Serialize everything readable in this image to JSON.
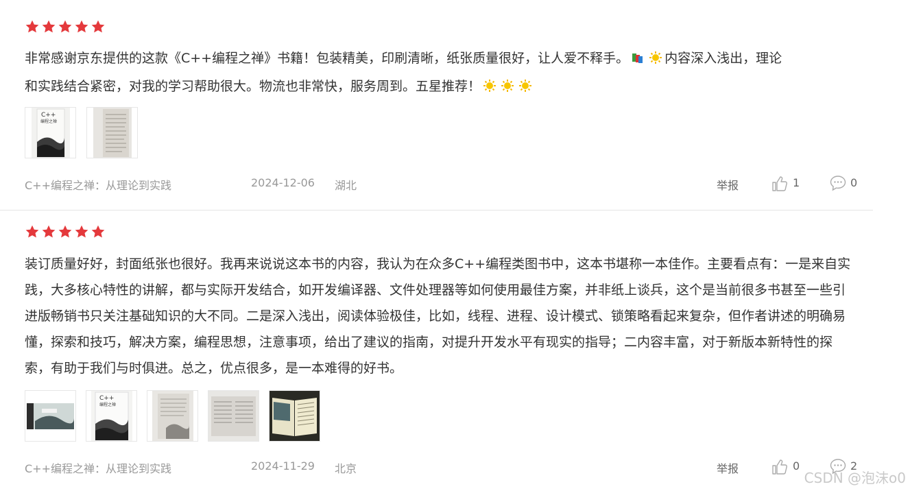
{
  "reviews": [
    {
      "rating": 5,
      "text_lines": [
        "非常感谢京东提供的这款《C++编程之禅》书籍！包装精美，印刷清晰，纸张质量很好，让人爱不释手。",
        "内容深入浅出，理论",
        "和实践结合紧密，对我的学习帮助很大。物流也非常快，服务周到。五星推荐！"
      ],
      "product": "C++编程之禅：从理论到实践",
      "date": "2024-12-06",
      "location": "湖北",
      "report": "举报",
      "likes": "1",
      "comments": "0",
      "photos": [
        "book-cover-photo",
        "book-page-photo"
      ]
    },
    {
      "rating": 5,
      "text": "装订质量好好，封面纸张也很好。我再来说说这本书的内容，我认为在众多C++编程类图书中，这本书堪称一本佳作。主要看点有：一是来自实践，大多核心特性的讲解，都与实际开发结合，如开发编译器、文件处理器等如何使用最佳方案，并非纸上谈兵，这个是当前很多书甚至一些引进版畅销书只关注基础知识的大不同。二是深入浅出，阅读体验极佳，比如，线程、进程、设计模式、锁策略看起来复杂，但作者讲述的明确易懂，探索和技巧，解决方案，编程思想，注意事项，给出了建议的指南，对提升开发水平有现实的指导；二内容丰富，对于新版本新特性的探索，有助于我们与时俱进。总之，优点很多，是一本难得的好书。",
      "product": "C++编程之禅：从理论到实践",
      "date": "2024-11-29",
      "location": "北京",
      "report": "举报",
      "likes": "0",
      "comments": "2",
      "photos": [
        "book-spread-photo",
        "book-cover-photo",
        "book-page-photo",
        "book-page-photo",
        "book-open-photo"
      ]
    }
  ],
  "watermark": "CSDN @泡沫o0",
  "colors": {
    "star": "#e4393c",
    "meta": "#999999",
    "text": "#333333",
    "divider": "#e5e5e5"
  }
}
